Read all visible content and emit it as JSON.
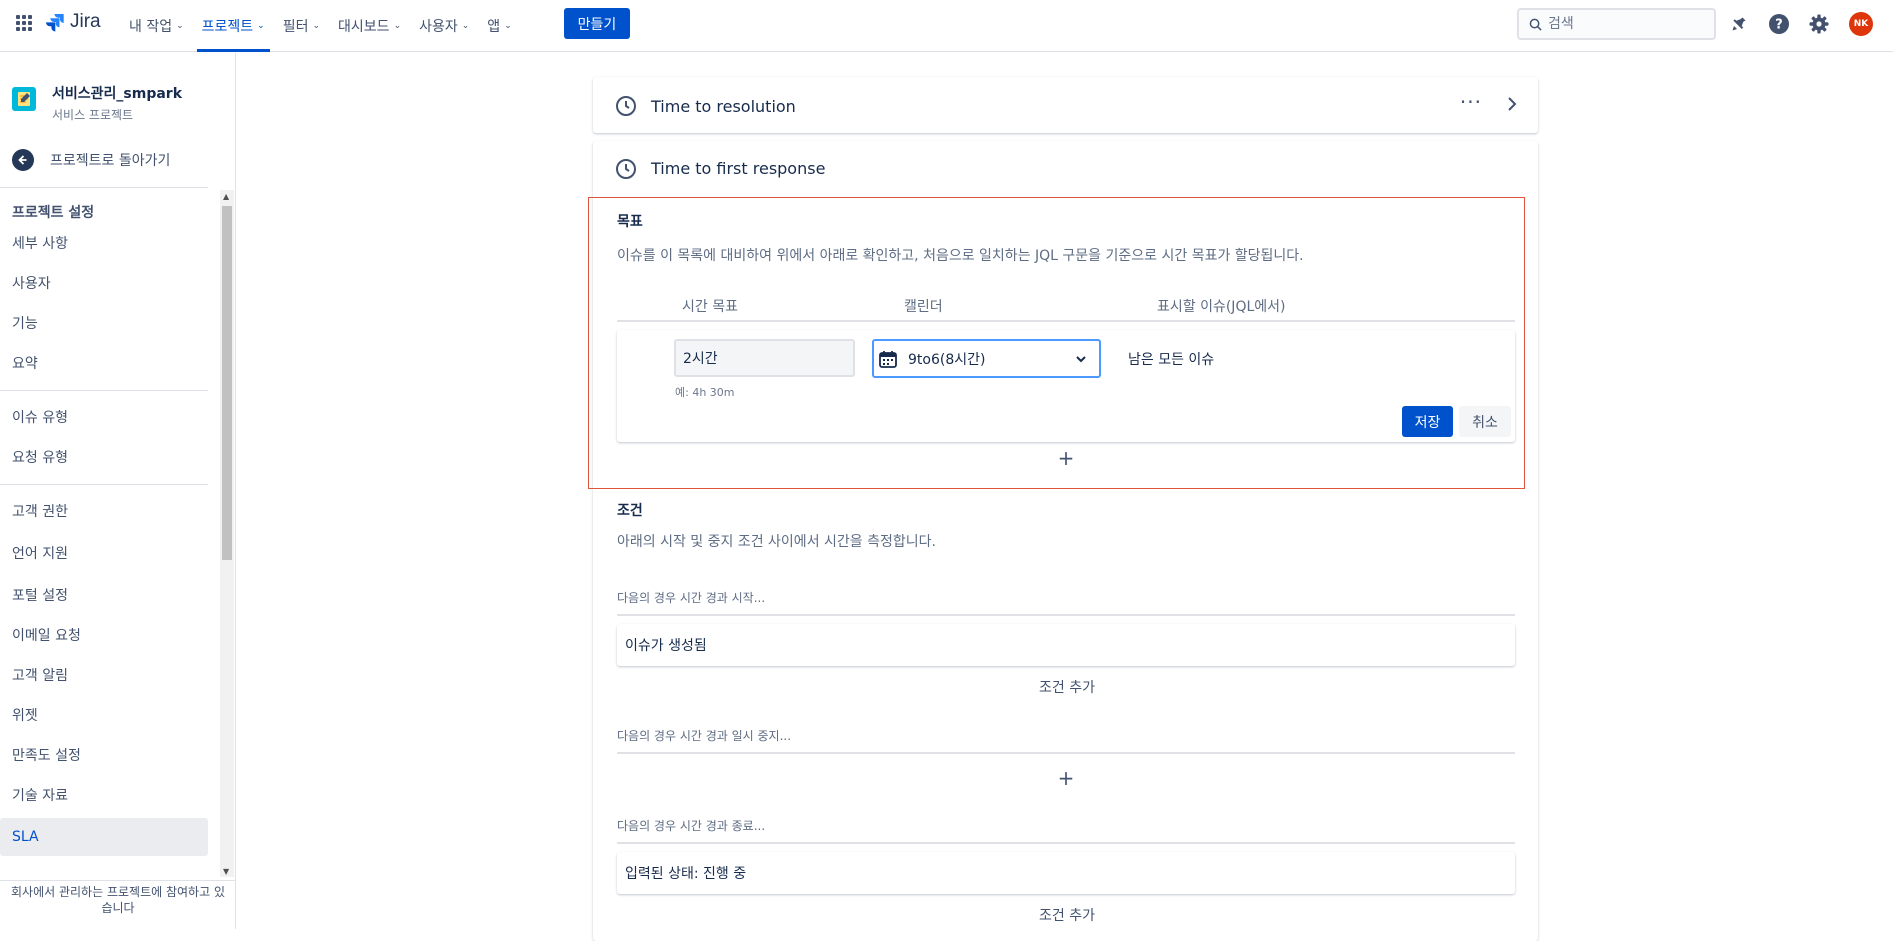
{
  "topnav": {
    "logo_text": "Jira",
    "menu": [
      {
        "label": "내 작업",
        "active": false
      },
      {
        "label": "프로젝트",
        "active": true
      },
      {
        "label": "필터",
        "active": false
      },
      {
        "label": "대시보드",
        "active": false
      },
      {
        "label": "사용자",
        "active": false
      },
      {
        "label": "앱",
        "active": false
      }
    ],
    "create_label": "만들기",
    "search_placeholder": "검색",
    "avatar_initials": "NK",
    "accent": "#0052cc"
  },
  "sidebar": {
    "project_name": "서비스관리_smpark",
    "project_type": "서비스 프로젝트",
    "back_label": "프로젝트로 돌아가기",
    "group_title": "프로젝트 설정",
    "items": [
      "세부 사항",
      "사용자",
      "기능",
      "요약",
      "이슈 유형",
      "요청 유형",
      "고객 권한",
      "언어 지원",
      "포털 설정",
      "이메일 요청",
      "고객 알림",
      "위젯",
      "만족도 설정",
      "기술 자료",
      "SLA"
    ],
    "selected_item": "SLA",
    "footer": "회사에서 관리하는 프로젝트에 참여하고 있습니다"
  },
  "main": {
    "sla_cards": [
      {
        "title": "Time to resolution"
      },
      {
        "title": "Time to first response"
      }
    ],
    "goals": {
      "title": "목표",
      "description": "이슈를 이 목록에 대비하여 위에서 아래로 확인하고, 처음으로 일치하는 JQL 구문을 기준으로 시간 목표가 할당됩니다.",
      "columns": [
        "시간 목표",
        "캘린더",
        "표시할 이슈(JQL에서)"
      ],
      "row": {
        "time_value": "2시간",
        "time_hint": "예: 4h 30m",
        "calendar": "9to6(8시간)",
        "jql": "남은 모든 이슈"
      },
      "save_label": "저장",
      "cancel_label": "취소",
      "add_symbol": "+"
    },
    "conditions": {
      "title": "조건",
      "description": "아래의 시작 및 중지 조건 사이에서 시간을 측정합니다.",
      "start_label": "다음의 경우 시간 경과 시작...",
      "start_value": "이슈가 생성됨",
      "add_condition": "조건 추가",
      "pause_label": "다음의 경우 시간 경과 일시 중지...",
      "stop_label": "다음의 경우 시간 경과 종료...",
      "stop_value": "입력된 상태: 진행 중"
    }
  }
}
